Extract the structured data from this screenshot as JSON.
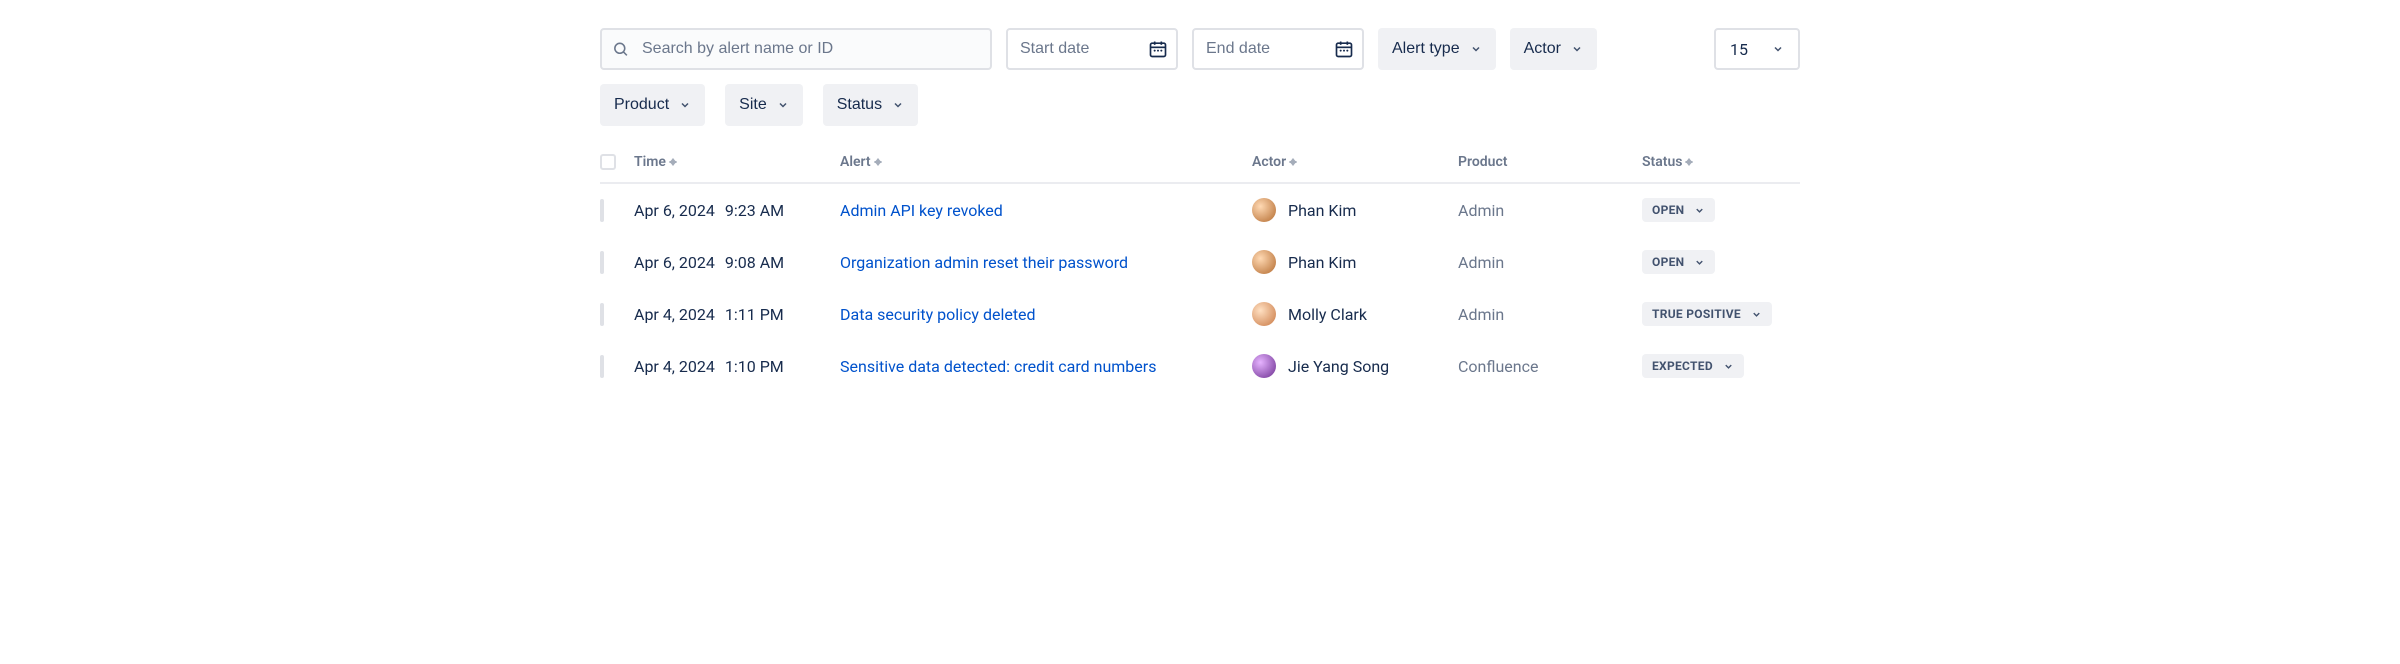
{
  "filters": {
    "search_placeholder": "Search by alert name or ID",
    "start_date_placeholder": "Start date",
    "end_date_placeholder": "End date",
    "alert_type_label": "Alert type",
    "actor_label": "Actor",
    "page_size": "15",
    "product_label": "Product",
    "site_label": "Site",
    "status_label": "Status"
  },
  "columns": {
    "time": "Time",
    "alert": "Alert",
    "actor": "Actor",
    "product": "Product",
    "status": "Status"
  },
  "rows": [
    {
      "date": "Apr 6, 2024",
      "time": "9:23 AM",
      "alert": "Admin API key revoked",
      "actor": "Phan Kim",
      "product": "Admin",
      "status": "OPEN",
      "avatar_class": "av1"
    },
    {
      "date": "Apr 6, 2024",
      "time": "9:08 AM",
      "alert": "Organization admin reset their password",
      "actor": "Phan Kim",
      "product": "Admin",
      "status": "OPEN",
      "avatar_class": "av1"
    },
    {
      "date": "Apr 4, 2024",
      "time": "1:11 PM",
      "alert": "Data security policy deleted",
      "actor": "Molly Clark",
      "product": "Admin",
      "status": "TRUE POSITIVE",
      "avatar_class": "av2"
    },
    {
      "date": "Apr 4, 2024",
      "time": "1:10 PM",
      "alert": "Sensitive data detected: credit card numbers",
      "actor": "Jie Yang Song",
      "product": "Confluence",
      "status": "EXPECTED",
      "avatar_class": "av3"
    }
  ]
}
